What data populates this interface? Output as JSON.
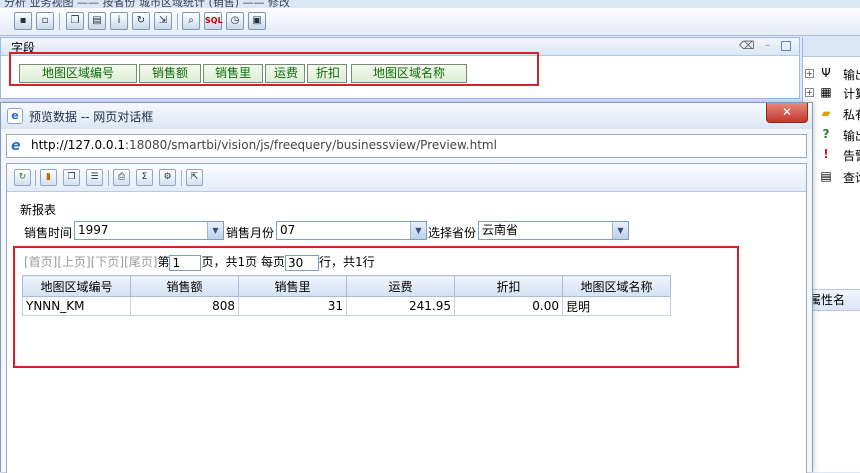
{
  "app": {
    "title_fragment": "分析  业务视图 —— 按省份 城市区域统计 (销售) —— 修改",
    "toolbar_icons": [
      "save-icon",
      "save-as-icon",
      "copy-icon",
      "table-icon",
      "info-icon",
      "refresh-icon",
      "export-icon",
      "search-icon",
      "sql-icon",
      "clock-icon",
      "window-icon"
    ],
    "sql_label": "SQL"
  },
  "fields_panel": {
    "title": "字段",
    "fields": [
      "地图区域编号",
      "销售额",
      "销售里",
      "运费",
      "折扣",
      "地图区域名称"
    ]
  },
  "right_panel": {
    "items": [
      {
        "icon": "filter-icon",
        "glyph": "Ψ",
        "label": "输出"
      },
      {
        "icon": "calculator-icon",
        "glyph": "▦",
        "label": "计算"
      },
      {
        "icon": "folder-icon",
        "glyph": "▰",
        "label": "私有"
      },
      {
        "icon": "help-icon",
        "glyph": "?",
        "label": "输出"
      },
      {
        "icon": "alert-icon",
        "glyph": "!",
        "label": "告警"
      },
      {
        "icon": "query-icon",
        "glyph": "▤",
        "label": "查询"
      }
    ],
    "property_header": "属性名"
  },
  "dialog": {
    "title": "预览数据 -- 网页对话框",
    "close_label": "✕",
    "url_host": "http://127.0.0.1",
    "url_rest": ":18080/smartbi/vision/js/freequery/businessview/Preview.html"
  },
  "report": {
    "title": "新报表",
    "params": [
      {
        "label": "销售时间",
        "value": "1997"
      },
      {
        "label": "销售月份",
        "value": "07"
      },
      {
        "label": "选择省份",
        "value": "云南省"
      }
    ],
    "pager": {
      "nav": "[首页][上页][下页][尾页]",
      "page_prefix": "第",
      "page_value": "1",
      "page_suffix": "页，共1页  每页",
      "rows_value": "30",
      "rows_suffix": "行，共1行"
    },
    "table": {
      "headers": [
        "地图区域编号",
        "销售额",
        "销售里",
        "运费",
        "折扣",
        "地图区域名称"
      ],
      "rows": [
        [
          "YNNN_KM",
          "808",
          "31",
          "241.95",
          "0.00",
          "昆明"
        ]
      ]
    }
  }
}
